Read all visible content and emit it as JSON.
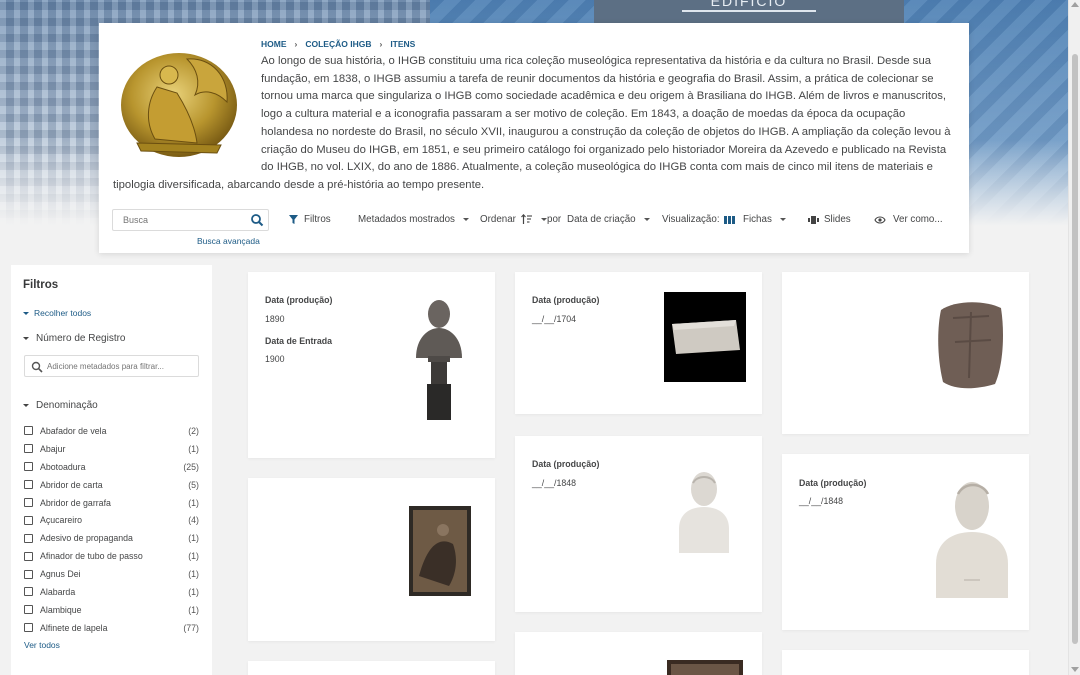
{
  "hero": {
    "sign_text": "EDIFÍCIO"
  },
  "breadcrumb": [
    "HOME",
    "COLEÇÃO IHGB",
    "ITENS"
  ],
  "description": "Ao longo de sua história, o IHGB constituiu uma rica coleção museológica representativa da história e da cultura no Brasil. Desde sua fundação, em 1838, o IHGB assumiu a tarefa de reunir documentos da história e geografia do Brasil. Assim, a prática de colecionar se tornou uma marca que singulariza o IHGB como sociedade acadêmica e deu origem à Brasiliana do IHGB. Além de livros e manuscritos, logo a cultura material e a iconografia passaram a ser motivo de coleção. Em 1843, a doação de moedas da época da ocupação holandesa no nordeste do Brasil, no século XVII, inaugurou a construção da coleção de objetos do IHGB. A ampliação da coleção levou à criação do Museu do IHGB, em 1851, e seu primeiro catálogo foi organizado pelo historiador Moreira da Azevedo e publicado na Revista do IHGB, no vol. LXIX, do ano de 1886. Atualmente, a coleção museológica do IHGB conta com mais de cinco mil itens de materiais e tipologia diversificada, abarcando desde a pré-história ao tempo presente.",
  "controls": {
    "search_placeholder": "Busca",
    "advanced_search": "Busca avançada",
    "filters": "Filtros",
    "metadata": "Metadados mostrados",
    "order": "Ordenar",
    "by": "por",
    "order_field": "Data de criação",
    "view_label": "Visualização:",
    "view_mode": "Fichas",
    "slides": "Slides",
    "see_as": "Ver como..."
  },
  "sidebar": {
    "title": "Filtros",
    "collapse_all": "Recolher todos",
    "section_registro": "Número de Registro",
    "meta_placeholder": "Adicione metadados para filtrar...",
    "section_denominacao": "Denominação",
    "facets": [
      {
        "label": "Abafador de vela",
        "count": "(2)"
      },
      {
        "label": "Abajur",
        "count": "(1)"
      },
      {
        "label": "Abotoadura",
        "count": "(25)"
      },
      {
        "label": "Abridor de carta",
        "count": "(5)"
      },
      {
        "label": "Abridor de garrafa",
        "count": "(1)"
      },
      {
        "label": "Açucareiro",
        "count": "(4)"
      },
      {
        "label": "Adesivo de propaganda",
        "count": "(1)"
      },
      {
        "label": "Afinador de tubo de passo",
        "count": "(1)"
      },
      {
        "label": "Agnus Dei",
        "count": "(1)"
      },
      {
        "label": "Alabarda",
        "count": "(1)"
      },
      {
        "label": "Alambique",
        "count": "(1)"
      },
      {
        "label": "Alfinete de lapela",
        "count": "(77)"
      }
    ],
    "see_all": "Ver todos"
  },
  "cards": {
    "c1": {
      "lbl1": "Data (produção)",
      "val1": "1890",
      "lbl2": "Data de Entrada",
      "val2": "1900"
    },
    "c2": {
      "lbl1": "Data (produção)",
      "val1": "__/__/1704"
    },
    "c4": {
      "lbl1": "Data (produção)",
      "val1": "__/__/1848"
    },
    "c5": {
      "lbl1": "Data (produção)",
      "val1": "__/__/1848"
    }
  }
}
